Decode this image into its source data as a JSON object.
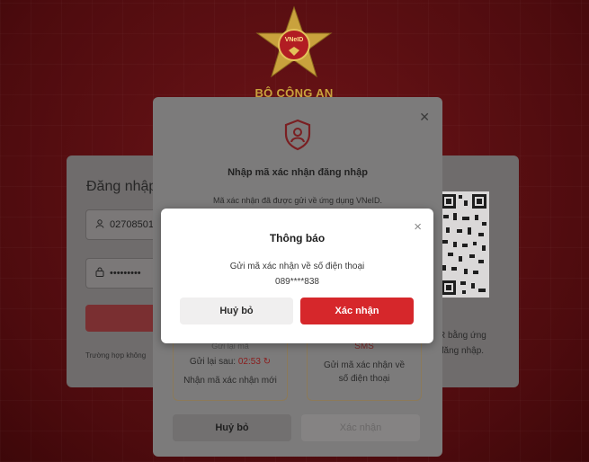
{
  "header": {
    "org_name": "BỘ CÔNG AN",
    "emblem_text": "VNeID"
  },
  "login": {
    "title": "Đăng nhập",
    "id_value": "02708501",
    "password_mask": "•••••••••",
    "help_text": "Trường hợp không"
  },
  "qr_panel": {
    "line1": "R bằng ứng",
    "line2": "đăng nhập."
  },
  "otp_modal": {
    "title": "Nhập mã xác nhận đăng nhập",
    "description": "Mã xác nhận đã được gửi về ứng dụng VNeID.",
    "resend_label": "Gửi lại mã",
    "resend_prefix": "Gửi lại sau:",
    "resend_time": "02:53",
    "receive_new": "Nhận mã xác nhận mới",
    "sms_label": "SMS",
    "sms_line1": "Gửi mã xác nhận về",
    "sms_line2": "số điện thoại",
    "cancel_label": "Huỷ bỏ",
    "confirm_label": "Xác nhận"
  },
  "dialog": {
    "title": "Thông báo",
    "message_line1": "Gửi mã xác nhận về số điện thoại",
    "message_line2": "089****838",
    "cancel_label": "Huỷ bỏ",
    "confirm_label": "Xác nhận",
    "close_glyph": "×"
  },
  "colors": {
    "brand_red": "#d6272b",
    "background": "#5a0f12",
    "gold": "#c9a23d"
  }
}
